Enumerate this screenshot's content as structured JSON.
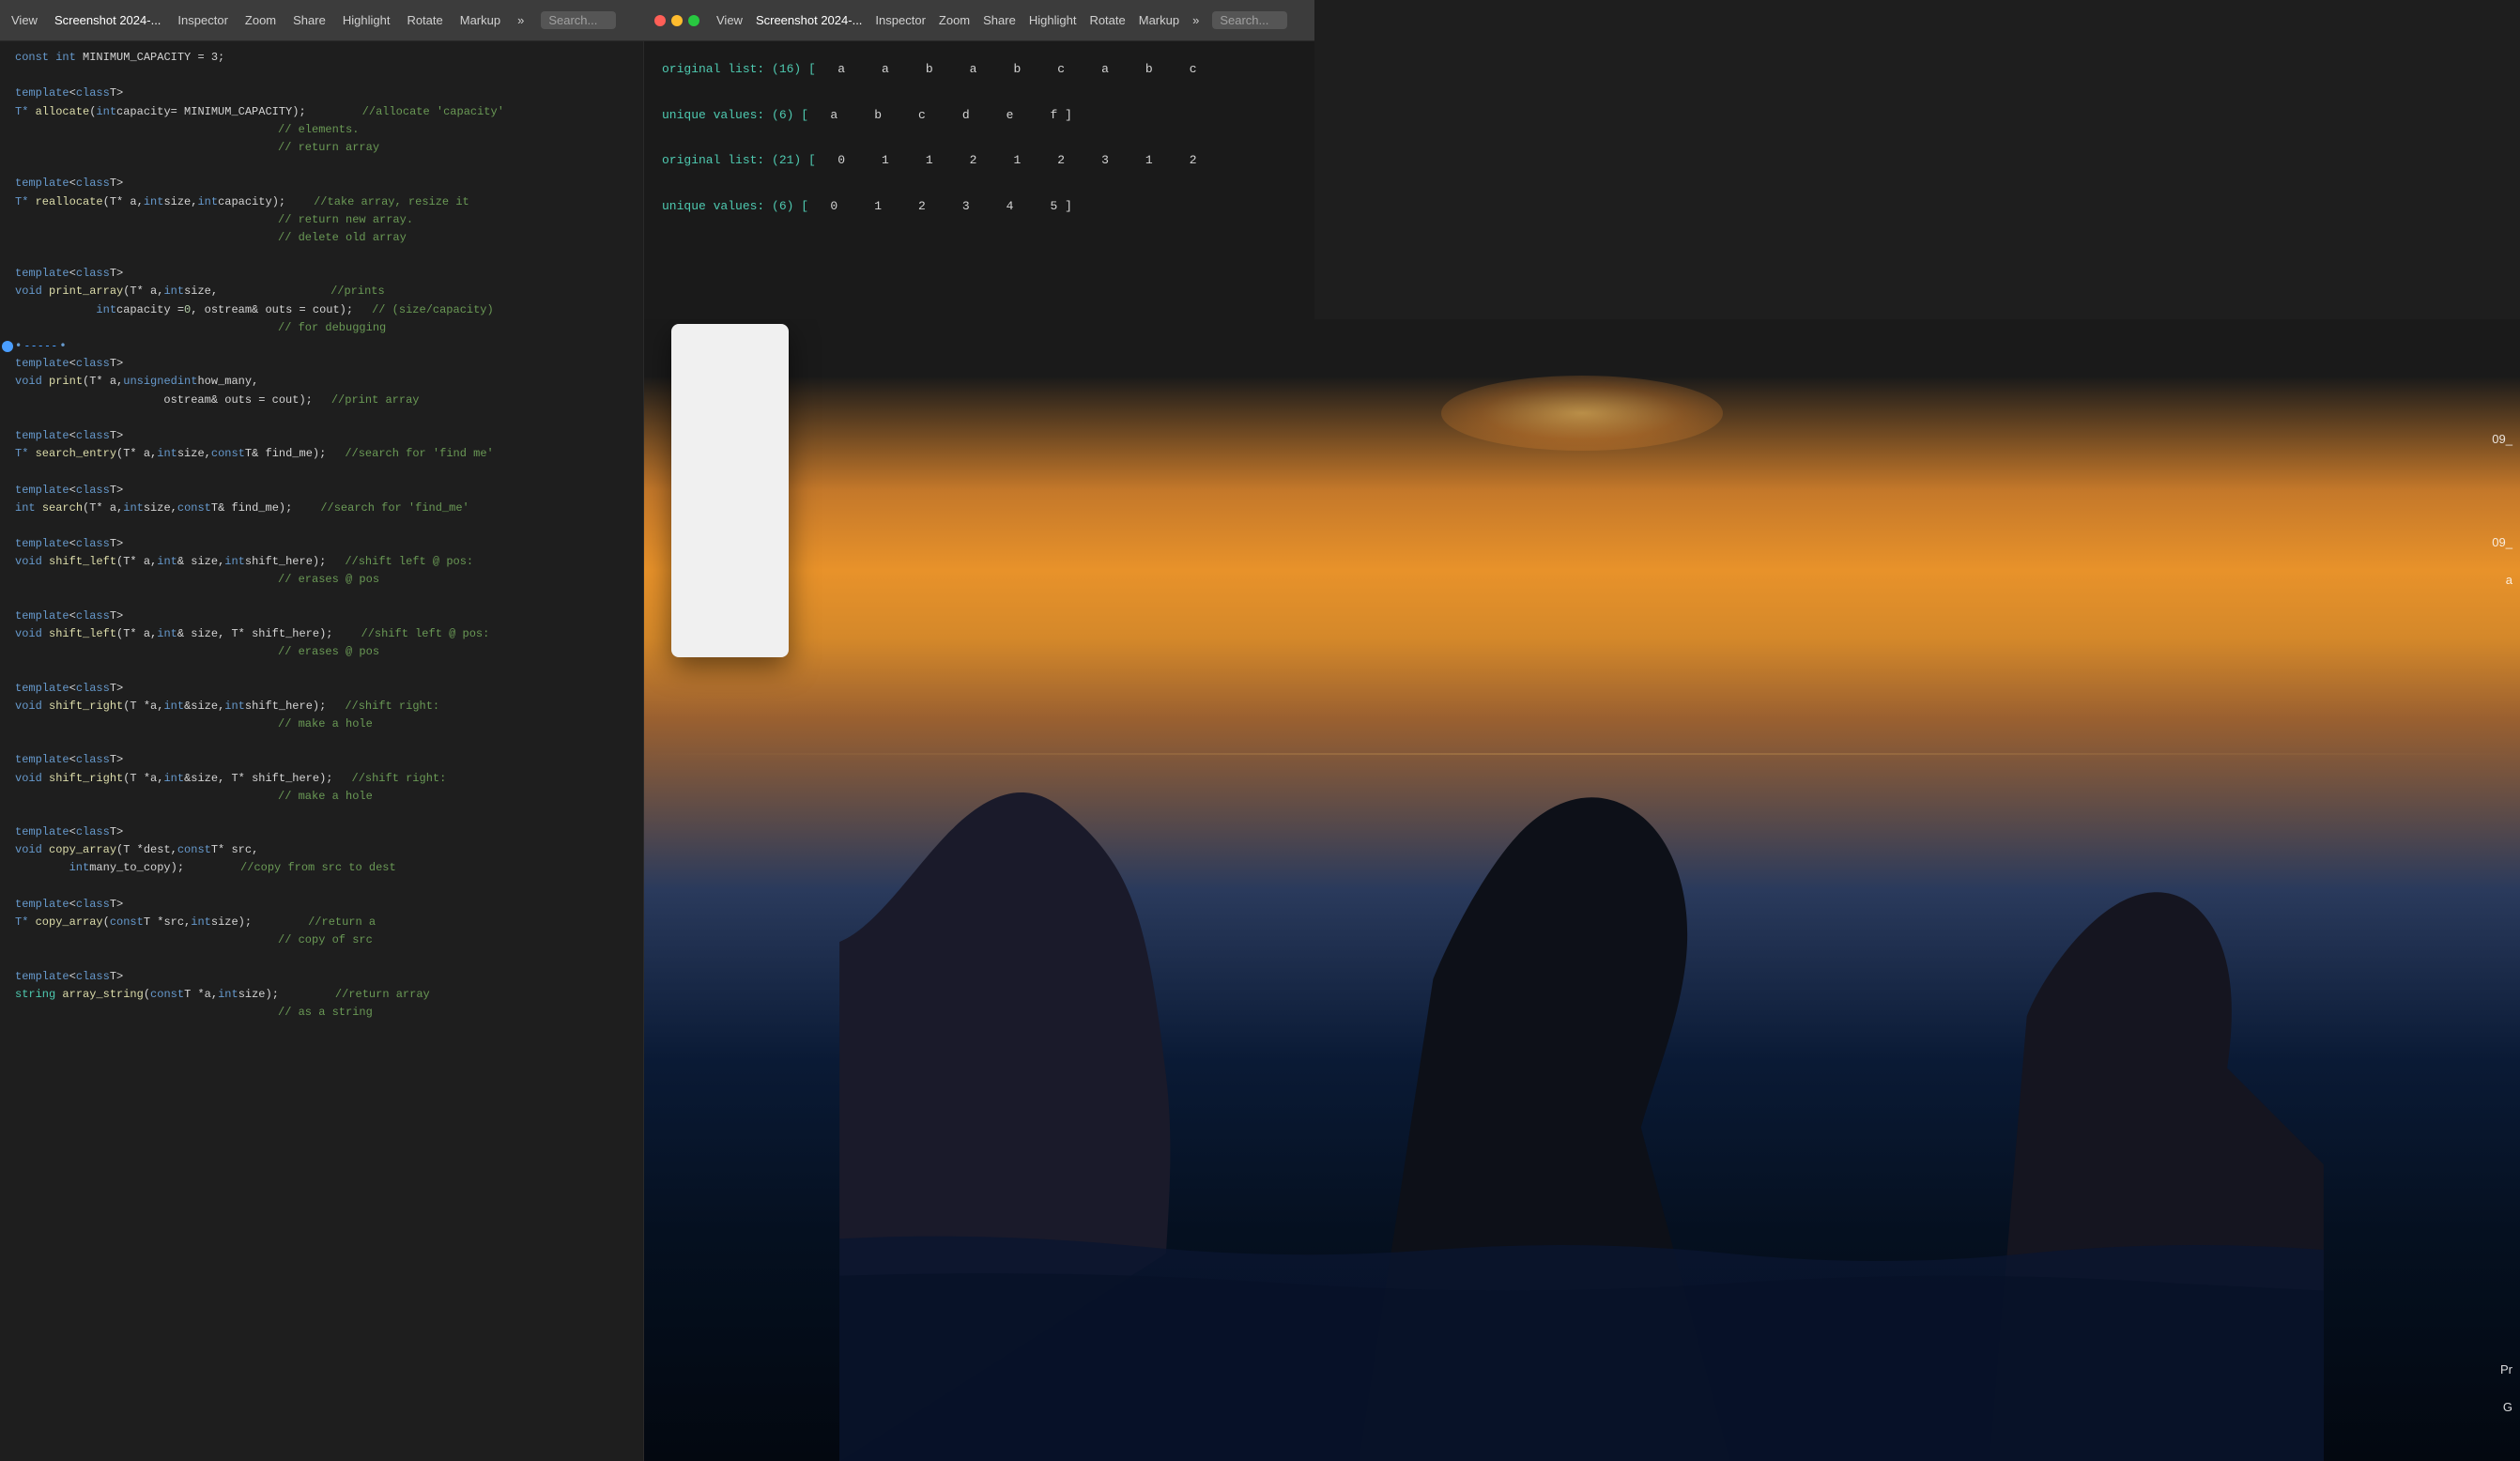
{
  "left_window": {
    "toolbar": {
      "view_label": "View",
      "title": "Screenshot 2024-...",
      "inspector_label": "Inspector",
      "zoom_label": "Zoom",
      "share_label": "Share",
      "highlight_label": "Highlight",
      "rotate_label": "Rotate",
      "markup_label": "Markup",
      "more_label": "»",
      "search_placeholder": "Search..."
    },
    "code_lines": [
      {
        "id": 1,
        "text": "const int MINIMUM_CAPACITY = 3;"
      },
      {
        "id": 2,
        "text": ""
      },
      {
        "id": 3,
        "text": "template<class T>"
      },
      {
        "id": 4,
        "text": "T* allocate(int capacity= MINIMUM_CAPACITY);"
      },
      {
        "id": 5,
        "text": "//allocate 'capacity'"
      },
      {
        "id": 6,
        "text": "//      elements."
      },
      {
        "id": 7,
        "text": "//  return array"
      },
      {
        "id": 8,
        "text": ""
      },
      {
        "id": 9,
        "text": "template<class T>"
      },
      {
        "id": 10,
        "text": "T* reallocate(T* a, int size, int capacity);"
      },
      {
        "id": 11,
        "text": "//take array, resize it"
      },
      {
        "id": 12,
        "text": "//  return new array."
      },
      {
        "id": 13,
        "text": "//  delete old array"
      },
      {
        "id": 14,
        "text": ""
      },
      {
        "id": 15,
        "text": "template<class T>"
      },
      {
        "id": 16,
        "text": "void print_array(T* a, int size,"
      },
      {
        "id": 17,
        "text": "        int capacity = 0, ostream& outs = cout);"
      },
      {
        "id": 18,
        "text": "//prints"
      },
      {
        "id": 19,
        "text": "//  (size/capacity)"
      },
      {
        "id": 20,
        "text": "//  for debugging"
      },
      {
        "id": 21,
        "text": "•-----•",
        "is_breakpoint": true
      },
      {
        "id": 22,
        "text": "template <class T>"
      },
      {
        "id": 23,
        "text": "void print(T* a, unsigned int how_many,"
      },
      {
        "id": 24,
        "text": "                      ostream& outs = cout);"
      },
      {
        "id": 25,
        "text": "//print array"
      },
      {
        "id": 26,
        "text": ""
      },
      {
        "id": 27,
        "text": "template <class T>"
      },
      {
        "id": 28,
        "text": "T* search_entry(T* a, int size, const T& find_me);"
      },
      {
        "id": 29,
        "text": "//search for 'find me'"
      },
      {
        "id": 30,
        "text": ""
      },
      {
        "id": 31,
        "text": "template <class T>"
      },
      {
        "id": 32,
        "text": "int search(T* a, int size, const T& find_me);"
      },
      {
        "id": 33,
        "text": "//search for 'find_me'"
      },
      {
        "id": 34,
        "text": ""
      },
      {
        "id": 35,
        "text": "template <class T>"
      },
      {
        "id": 36,
        "text": "void shift_left(T* a, int& size, int shift_here);"
      },
      {
        "id": 37,
        "text": "//shift left @ pos:"
      },
      {
        "id": 38,
        "text": "//    erases @ pos"
      },
      {
        "id": 39,
        "text": ""
      },
      {
        "id": 40,
        "text": "template <class T>"
      },
      {
        "id": 41,
        "text": "void shift_left(T* a, int& size, T* shift_here);"
      },
      {
        "id": 42,
        "text": "//shift left @ pos:"
      },
      {
        "id": 43,
        "text": "//    erases @ pos"
      },
      {
        "id": 44,
        "text": ""
      },
      {
        "id": 45,
        "text": "template <class T>"
      },
      {
        "id": 46,
        "text": "void shift_right(T *a, int &size, int shift_here);"
      },
      {
        "id": 47,
        "text": "//shift right:"
      },
      {
        "id": 48,
        "text": "//      make a hole"
      },
      {
        "id": 49,
        "text": ""
      },
      {
        "id": 50,
        "text": "template <class T>"
      },
      {
        "id": 51,
        "text": "void shift_right(T *a, int &size, T* shift_here);"
      },
      {
        "id": 52,
        "text": "//shift right:"
      },
      {
        "id": 53,
        "text": "//  make a hole"
      },
      {
        "id": 54,
        "text": ""
      },
      {
        "id": 55,
        "text": "template <class T>"
      },
      {
        "id": 56,
        "text": "void copy_array(T *dest, const T* src,"
      },
      {
        "id": 57,
        "text": "        int many_to_copy);"
      },
      {
        "id": 58,
        "text": "//copy from src to dest"
      },
      {
        "id": 59,
        "text": ""
      },
      {
        "id": 60,
        "text": "template <class T>"
      },
      {
        "id": 61,
        "text": "T* copy_array(const T *src, int size);"
      },
      {
        "id": 62,
        "text": "//return a"
      },
      {
        "id": 63,
        "text": "//    copy of src"
      },
      {
        "id": 64,
        "text": ""
      },
      {
        "id": 65,
        "text": "template <class T>"
      },
      {
        "id": 66,
        "text": "string array_string(const T *a, int size);"
      },
      {
        "id": 67,
        "text": "//return array"
      },
      {
        "id": 68,
        "text": "//   as a string"
      }
    ]
  },
  "right_window": {
    "toolbar": {
      "view_label": "View",
      "title": "Screenshot 2024-...",
      "inspector_label": "Inspector",
      "zoom_label": "Zoom",
      "share_label": "Share",
      "highlight_label": "Highlight",
      "rotate_label": "Rotate",
      "markup_label": "Markup",
      "more_label": "»",
      "search_placeholder": "Search..."
    },
    "terminal_output": [
      {
        "label": "original list: (16) [",
        "values": [
          "a",
          "a",
          "b",
          "a",
          "b",
          "c",
          "a",
          "b",
          "c"
        ],
        "suffix": ""
      },
      {
        "label": "unique values: (6) [",
        "values": [
          "a",
          "b",
          "c",
          "d",
          "e",
          "f ]"
        ],
        "suffix": ""
      },
      {
        "label": "original list: (21) [",
        "values": [
          "0",
          "1",
          "1",
          "2",
          "1",
          "2",
          "3",
          "1",
          "2"
        ],
        "suffix": ""
      },
      {
        "label": "unique values: (6) [",
        "values": [
          "0",
          "1",
          "2",
          "3",
          "4",
          "5 ]"
        ],
        "suffix": ""
      }
    ]
  },
  "image_panel": {
    "edge_labels": [
      "09_",
      "09_",
      "a"
    ],
    "popup_card": {
      "visible": true
    }
  }
}
